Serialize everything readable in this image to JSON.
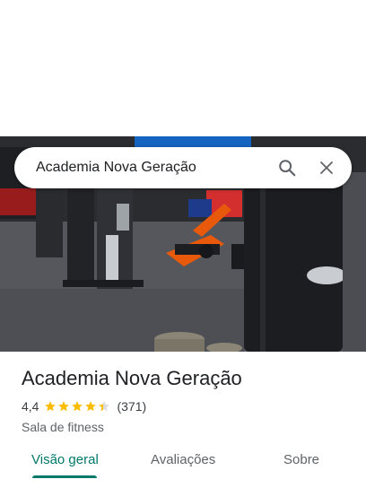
{
  "search": {
    "query": "Academia Nova Geração",
    "search_icon": "search-icon",
    "close_icon": "close-icon"
  },
  "place": {
    "name": "Academia Nova Geração",
    "rating": "4,4",
    "rating_value": 4.4,
    "stars_max": 5,
    "reviews": "(371)",
    "category": "Sala de fitness"
  },
  "tabs": [
    {
      "label": "Visão geral",
      "active": true
    },
    {
      "label": "Avaliações",
      "active": false
    },
    {
      "label": "Sobre",
      "active": false
    }
  ],
  "colors": {
    "accent": "#00796b",
    "star": "#fbbc04",
    "equipment_orange": "#e8590c",
    "equipment_red": "#d32f2f"
  }
}
